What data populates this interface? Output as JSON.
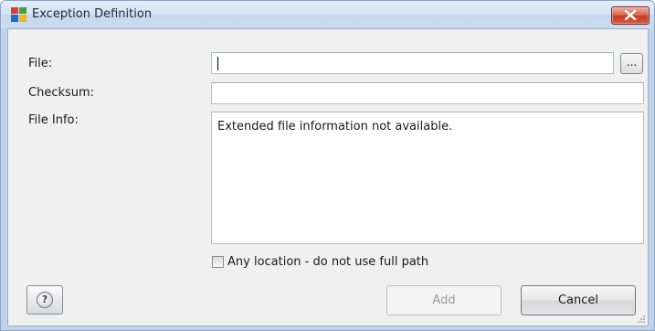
{
  "window": {
    "title": "Exception Definition",
    "app_icon": "avg-logo-icon",
    "close_icon": "close-icon"
  },
  "form": {
    "file": {
      "label": "File:",
      "value": "",
      "browse_label": "..."
    },
    "checksum": {
      "label": "Checksum:",
      "value": ""
    },
    "file_info": {
      "label": "File Info:",
      "value": "Extended file information not available."
    },
    "any_location": {
      "label": "Any location - do not use full path",
      "checked": false
    }
  },
  "buttons": {
    "help_icon": "help-icon",
    "help_glyph": "?",
    "add_label": "Add",
    "add_enabled": false,
    "cancel_label": "Cancel"
  },
  "colors": {
    "title_bar": "#c9dcf2",
    "close_button": "#c94a32",
    "client_background": "#f0f0f0"
  }
}
